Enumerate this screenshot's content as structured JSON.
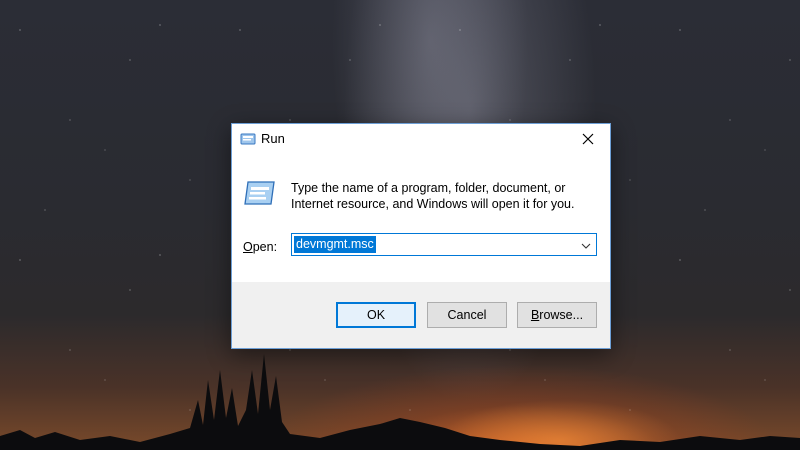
{
  "window": {
    "title": "Run",
    "title_icon": "run-icon",
    "close_icon": "close-icon"
  },
  "dialog": {
    "icon": "run-program-icon",
    "instruction_line1": "Type the name of a program, folder, document, or",
    "instruction_line2": "Internet resource, and Windows will open it for you.",
    "open_label_mnemonic": "O",
    "open_label_rest": "pen:",
    "open_value": "devmgmt.msc",
    "dropdown_icon": "chevron-down-icon"
  },
  "buttons": {
    "ok": "OK",
    "cancel": "Cancel",
    "browse_mnemonic": "B",
    "browse_rest": "rowse..."
  },
  "colors": {
    "accent": "#0078d7",
    "footer_bg": "#f0f0f0",
    "button_bg": "#e1e1e1"
  }
}
